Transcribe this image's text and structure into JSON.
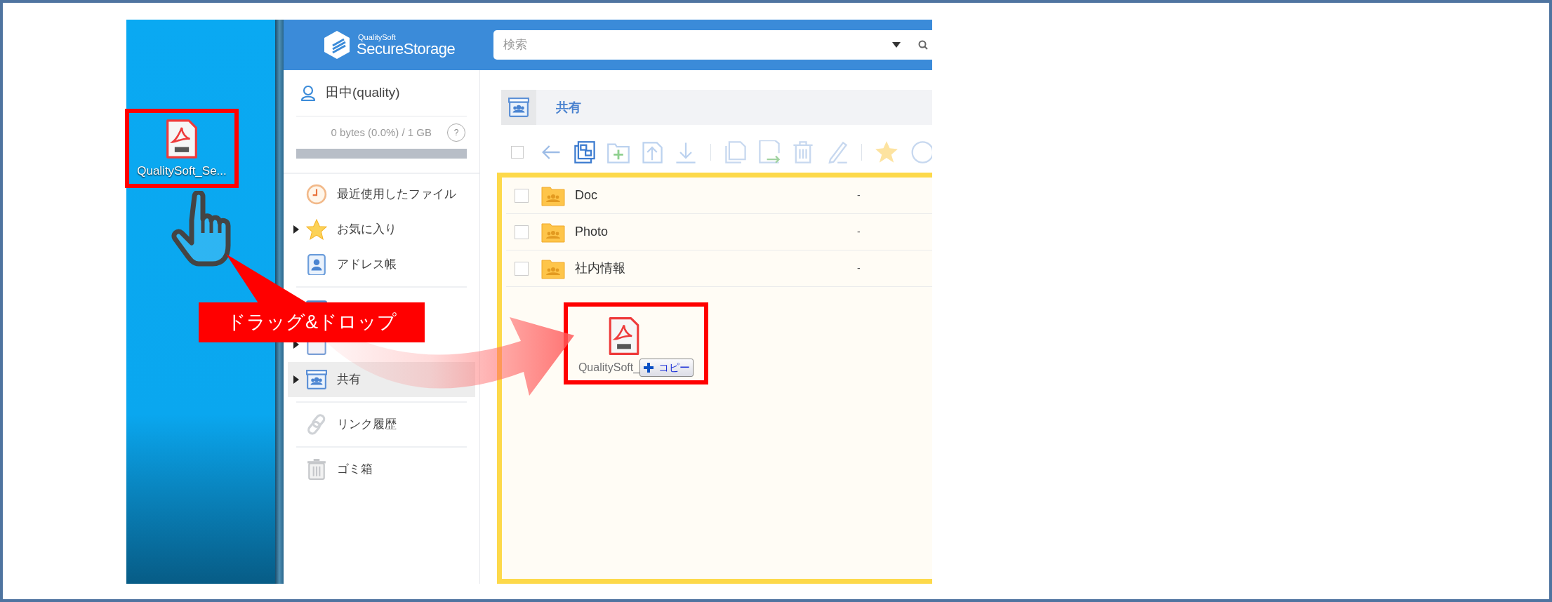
{
  "desktop": {
    "file_label": "QualitySoft_Se..."
  },
  "header": {
    "logo_small": "QualitySoft",
    "logo_large": "SecureStorage",
    "search": {
      "placeholder": "検索"
    }
  },
  "sidebar": {
    "user": "田中(quality)",
    "storage": "0 bytes (0.0%) / 1 GB",
    "help": "?",
    "level": 0,
    "sections": [
      {
        "items": [
          {
            "kind": "clock",
            "label": "最近使用したファイル",
            "expandable": false,
            "selected": false
          },
          {
            "kind": "star",
            "label": "お気に入り",
            "expandable": true,
            "selected": false
          },
          {
            "kind": "contacts",
            "label": "アドレス帳",
            "expandable": false,
            "selected": false
          }
        ]
      },
      {
        "items": [
          {
            "kind": "room",
            "expandable": false,
            "selected": false
          },
          {
            "kind": "box",
            "expandable": true,
            "selected": false
          },
          {
            "kind": "shared",
            "label": "共有",
            "expandable": true,
            "selected": true
          }
        ]
      },
      {
        "items": [
          {
            "kind": "link",
            "label": "リンク履歴",
            "expandable": false,
            "selected": false
          }
        ]
      },
      {
        "items": [
          {
            "kind": "trash",
            "label": "ゴミ箱",
            "expandable": false,
            "selected": false
          }
        ]
      }
    ]
  },
  "main": {
    "breadcrumb": "共有",
    "select_all_checked": false,
    "rows": [
      {
        "name": "Doc",
        "type": "-",
        "checked": false
      },
      {
        "name": "Photo",
        "type": "-",
        "checked": false
      },
      {
        "name": "社内情報",
        "type": "-",
        "checked": false
      }
    ],
    "drop": {
      "file_label": "QualitySoft_",
      "badge": "コピー"
    }
  },
  "callout": "ドラッグ&ドロップ"
}
